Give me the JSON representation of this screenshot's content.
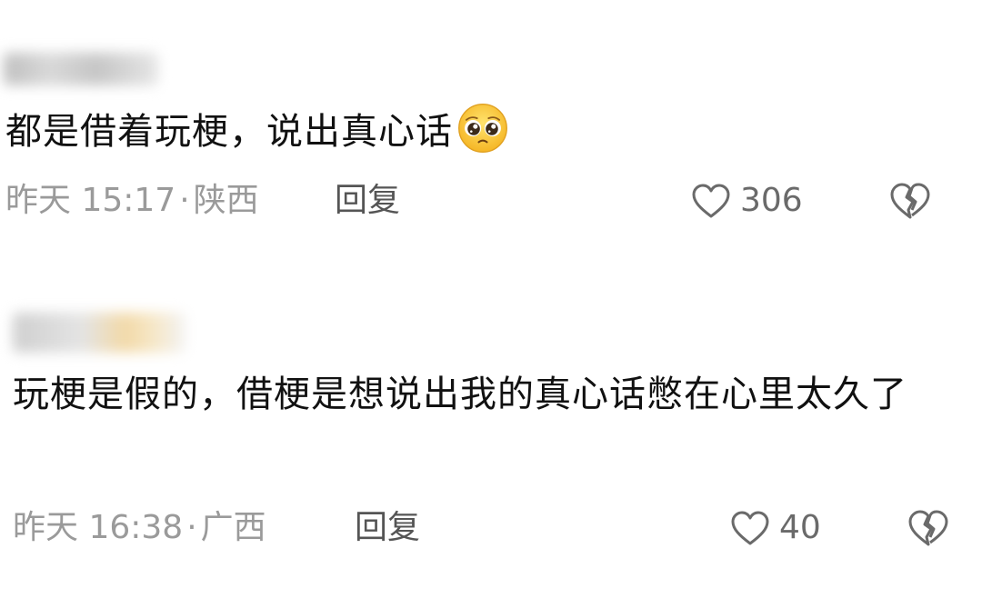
{
  "comments": [
    {
      "text": "都是借着玩梗，说出真心话",
      "emoji": "pleading-face-icon",
      "time": "昨天 15:17",
      "location": "陕西",
      "reply_label": "回复",
      "likes": "306"
    },
    {
      "text": "玩梗是假的，借梗是想说出我的真心话憋在心里太久了",
      "time": "昨天 16:38",
      "location": "广西",
      "reply_label": "回复",
      "likes": "40"
    }
  ],
  "separator": "·",
  "colors": {
    "text": "#111111",
    "meta": "#9a9a9a",
    "action": "#555555",
    "icon": "#6a6a6a",
    "background": "#ffffff"
  }
}
